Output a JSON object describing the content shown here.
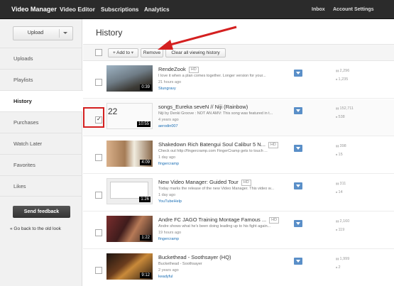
{
  "topnav": {
    "video_manager": "Video Manager",
    "video_editor": "Video Editor",
    "subscriptions": "Subscriptions",
    "analytics": "Analytics",
    "inbox": "Inbox",
    "account_settings": "Account Settings"
  },
  "sidebar": {
    "upload_label": "Upload",
    "items": [
      {
        "label": "Uploads"
      },
      {
        "label": "Playlists"
      },
      {
        "label": "History"
      },
      {
        "label": "Purchases"
      },
      {
        "label": "Watch Later"
      },
      {
        "label": "Favorites"
      },
      {
        "label": "Likes"
      }
    ],
    "active_item": "History",
    "feedback_label": "Send feedback",
    "old_look_label": "« Go back to the old look"
  },
  "main": {
    "title": "History",
    "toolbar": {
      "add_to_label": "+ Add to",
      "remove_label": "Remove",
      "clear_label": "Clear all viewing history"
    },
    "videos": [
      {
        "title": "RendeZook",
        "hd": "HD",
        "desc": "I love it when a plan comes together. Longer version for your...",
        "age": "21 hours ago",
        "user": "Stungravy",
        "duration": "0:39",
        "views": "2,296",
        "likes": "1,235",
        "checked": false
      },
      {
        "title": "songs_Eureka seveN // Niji (Rainbow)",
        "hd": "",
        "desc": "Niji by Denki Groove : NOT AN AMV: This song was featured in t...",
        "age": "4 years ago",
        "user": "aerodin007",
        "duration": "10:55",
        "views": "152,711",
        "likes": "538",
        "checked": true
      },
      {
        "title": "Shakedown Rich Batengui Soul Calibur 5 N...",
        "hd": "HD",
        "desc": "Check out http://fingercramp.com FingerCramp gets to touch ...",
        "age": "1 day ago",
        "user": "fingercramp",
        "duration": "4:09",
        "views": "398",
        "likes": "15",
        "checked": false
      },
      {
        "title": "New Video Manager: Guided Tour",
        "hd": "HD",
        "desc": "Today marks the release of the new Video Manager. This video w...",
        "age": "1 day ago",
        "user": "YouTubeHelp",
        "duration": "1:26",
        "views": "311",
        "likes": "14",
        "checked": false
      },
      {
        "title": "Andre FC JAGO Training Montage Famous ...",
        "hd": "HD",
        "desc": "Andre shows what he's been doing leading up to his fight again...",
        "age": "19 hours ago",
        "user": "fingercramp",
        "duration": "1:22",
        "views": "2,160",
        "likes": "119",
        "checked": false
      },
      {
        "title": "Buckethead - Soothsayer (HQ)",
        "hd": "",
        "desc": "Buckethead - Soothsayer",
        "age": "2 years ago",
        "user": "keadyful",
        "duration": "9:12",
        "views": "1,999",
        "likes": "2",
        "checked": false
      }
    ]
  },
  "colors": {
    "topbar_bg": "#2b2b2b",
    "link": "#1a6eb5",
    "download": "#5a8fc8",
    "annotation_arrow": "#d42020"
  }
}
